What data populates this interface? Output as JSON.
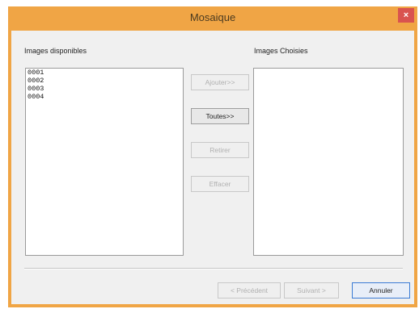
{
  "window": {
    "title": "Mosaique",
    "close_label": "×"
  },
  "available": {
    "label": "Images disponibles",
    "items": [
      "0001",
      "0002",
      "0003",
      "0004"
    ]
  },
  "chosen": {
    "label": "Images Choisies",
    "items": []
  },
  "actions": {
    "add_label": "Ajouter>>",
    "all_label": "Toutes>>",
    "remove_label": "Retirer",
    "clear_label": "Effacer"
  },
  "footer": {
    "previous_label": "< Précédent",
    "next_label": "Suivant >",
    "cancel_label": "Annuler"
  }
}
